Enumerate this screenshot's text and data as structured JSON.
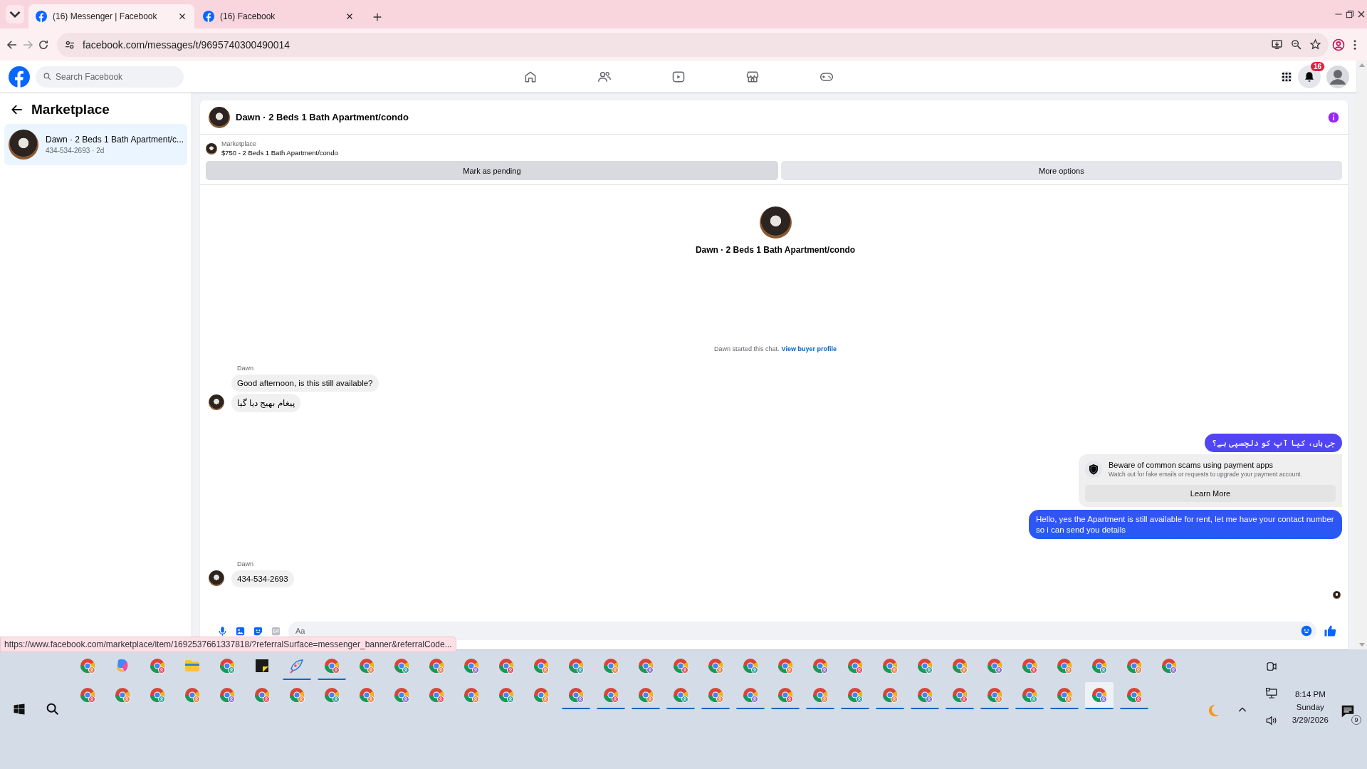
{
  "browser": {
    "tabs": [
      {
        "title": "(16) Messenger | Facebook",
        "selected": true
      },
      {
        "title": "(16) Facebook",
        "selected": false
      }
    ],
    "url": "facebook.com/messages/t/9695740300490014"
  },
  "facebook_header": {
    "search": {
      "placeholder": "Search Facebook"
    },
    "notification_count": "16"
  },
  "sidebar": {
    "title": "Marketplace",
    "conversations": [
      {
        "title": "Dawn · 2 Beds 1 Bath Apartment/c...",
        "subtitle": "434-534-2693 · 2d",
        "selected": true
      }
    ]
  },
  "chat": {
    "title": "Dawn · 2 Beds 1 Bath Apartment/condo",
    "listing": {
      "label": "Marketplace",
      "title": "$750 - 2 Beds 1 Bath Apartment/condo"
    },
    "actions": [
      "Mark as pending",
      "More options"
    ],
    "profile_name": "Dawn · 2 Beds 1 Bath Apartment/condo",
    "notice": {
      "text": "Dawn started this chat.",
      "link": "View buyer profile"
    },
    "messages": [
      {
        "kind": "incoming",
        "sender": "Dawn",
        "bubbles": [
          "Good afternoon, is this still available?",
          "پیغام بھیج دیا گیا"
        ]
      },
      {
        "kind": "outgoing",
        "bubbles": [
          "جی ہاں، کیا آپ کو دلچسپی ہے؟"
        ]
      },
      {
        "kind": "warning",
        "title": "Beware of common scams using payment apps",
        "text": "Watch out for fake emails or requests to upgrade your payment account.",
        "button": "Learn More"
      },
      {
        "kind": "outgoing",
        "bubbles": [
          "Hello, yes the Apartment is still available for rent, let me have your contact number so i can send you details"
        ]
      },
      {
        "kind": "incoming",
        "sender": "Dawn",
        "bubbles": [
          "434-534-2693"
        ]
      }
    ],
    "composer": {
      "placeholder": "Aa"
    }
  },
  "status_url": "https://www.facebook.com/marketplace/item/1692537661337818/?referralSurface=messenger_banner&referralCode...",
  "taskbar": {
    "apps_top": [
      {
        "kind": "browser",
        "running": false,
        "selected": false
      },
      {
        "kind": "assistant",
        "running": false,
        "selected": false
      },
      {
        "kind": "browser",
        "running": false,
        "selected": false
      },
      {
        "kind": "folder",
        "running": false,
        "selected": false
      },
      {
        "kind": "browser",
        "running": false,
        "selected": false
      },
      {
        "kind": "notes",
        "running": false,
        "selected": false
      },
      {
        "kind": "paint",
        "running": true,
        "selected": false
      },
      {
        "kind": "browser",
        "running": true,
        "selected": false
      },
      {
        "kind": "browser",
        "running": false,
        "selected": false
      },
      {
        "kind": "browser",
        "running": false,
        "selected": false
      },
      {
        "kind": "browser",
        "running": false,
        "selected": false
      },
      {
        "kind": "browser",
        "running": false,
        "selected": false
      },
      {
        "kind": "browser",
        "running": false,
        "selected": false
      },
      {
        "kind": "browser",
        "running": false,
        "selected": false
      },
      {
        "kind": "browser",
        "running": false,
        "selected": false
      },
      {
        "kind": "browser",
        "running": false,
        "selected": false
      },
      {
        "kind": "browser",
        "running": false,
        "selected": false
      },
      {
        "kind": "browser",
        "running": false,
        "selected": false
      },
      {
        "kind": "browser",
        "running": false,
        "selected": false
      },
      {
        "kind": "browser",
        "running": false,
        "selected": false
      },
      {
        "kind": "browser",
        "running": false,
        "selected": false
      },
      {
        "kind": "browser",
        "running": false,
        "selected": false
      },
      {
        "kind": "browser",
        "running": false,
        "selected": false
      },
      {
        "kind": "browser",
        "running": false,
        "selected": false
      },
      {
        "kind": "browser",
        "running": false,
        "selected": false
      },
      {
        "kind": "browser",
        "running": false,
        "selected": false
      },
      {
        "kind": "browser",
        "running": false,
        "selected": false
      },
      {
        "kind": "browser",
        "running": false,
        "selected": false
      },
      {
        "kind": "browser",
        "running": false,
        "selected": false
      },
      {
        "kind": "browser",
        "running": false,
        "selected": false
      },
      {
        "kind": "browser",
        "running": false,
        "selected": false
      },
      {
        "kind": "browser",
        "running": false,
        "selected": false
      }
    ],
    "apps_bottom": [
      {
        "kind": "browser",
        "running": false,
        "selected": false
      },
      {
        "kind": "browser",
        "running": false,
        "selected": false
      },
      {
        "kind": "browser",
        "running": false,
        "selected": false
      },
      {
        "kind": "browser",
        "running": false,
        "selected": false
      },
      {
        "kind": "browser",
        "running": false,
        "selected": false
      },
      {
        "kind": "browser",
        "running": false,
        "selected": false
      },
      {
        "kind": "browser",
        "running": false,
        "selected": false
      },
      {
        "kind": "browser",
        "running": false,
        "selected": false
      },
      {
        "kind": "browser",
        "running": false,
        "selected": false
      },
      {
        "kind": "browser",
        "running": false,
        "selected": false
      },
      {
        "kind": "browser",
        "running": false,
        "selected": false
      },
      {
        "kind": "browser",
        "running": false,
        "selected": false
      },
      {
        "kind": "browser",
        "running": false,
        "selected": false
      },
      {
        "kind": "browser",
        "running": false,
        "selected": false
      },
      {
        "kind": "browser",
        "running": true,
        "selected": false
      },
      {
        "kind": "browser",
        "running": true,
        "selected": false
      },
      {
        "kind": "browser",
        "running": true,
        "selected": false
      },
      {
        "kind": "browser",
        "running": true,
        "selected": false
      },
      {
        "kind": "browser",
        "running": true,
        "selected": false
      },
      {
        "kind": "browser",
        "running": true,
        "selected": false
      },
      {
        "kind": "browser",
        "running": true,
        "selected": false
      },
      {
        "kind": "browser",
        "running": true,
        "selected": false
      },
      {
        "kind": "browser",
        "running": true,
        "selected": false
      },
      {
        "kind": "browser",
        "running": true,
        "selected": false
      },
      {
        "kind": "browser",
        "running": true,
        "selected": false
      },
      {
        "kind": "browser",
        "running": true,
        "selected": false
      },
      {
        "kind": "browser",
        "running": true,
        "selected": false
      },
      {
        "kind": "browser",
        "running": true,
        "selected": false
      },
      {
        "kind": "browser",
        "running": true,
        "selected": false
      },
      {
        "kind": "browser",
        "running": true,
        "selected": true
      },
      {
        "kind": "browser",
        "running": true,
        "selected": false
      }
    ],
    "time": "8:14 PM",
    "day": "Sunday",
    "date": "3/29/2026",
    "notification_count": "9"
  }
}
